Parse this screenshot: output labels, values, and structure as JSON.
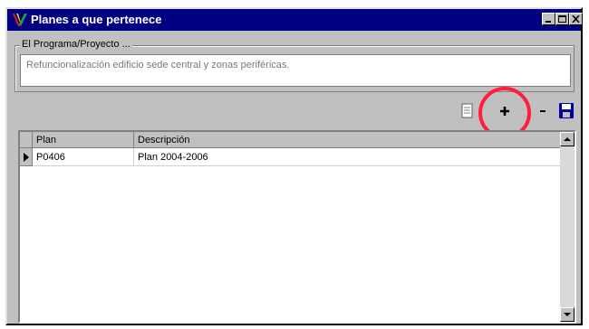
{
  "window": {
    "title": "Planes a que pertenece"
  },
  "program": {
    "label": "El Programa/Proyecto ...",
    "value": "Refuncionalización edificio sede central y zonas periféricas."
  },
  "toolbar": {
    "icons": [
      "document-icon",
      "add-icon",
      "remove-icon",
      "save-icon"
    ],
    "add_label": "+",
    "remove_label": "-"
  },
  "grid": {
    "columns": [
      "Plan",
      "Descripción"
    ],
    "rows": [
      {
        "plan": "P0406",
        "descripcion": "Plan 2004-2006"
      }
    ]
  },
  "colors": {
    "titlebar": "#000080",
    "highlight": "#ff1f3d",
    "save": "#0000a0"
  }
}
